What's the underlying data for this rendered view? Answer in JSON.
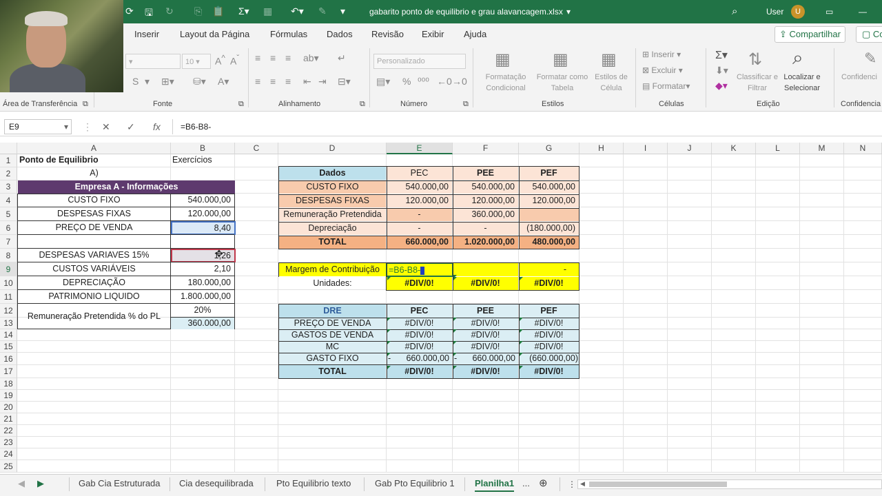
{
  "titlebar": {
    "filename": "gabarito ponto de equilibrio e grau alavancagem.xlsx",
    "user": "User",
    "user_initial": "U"
  },
  "ribbon_tabs": [
    "Inserir",
    "Layout da Página",
    "Fórmulas",
    "Dados",
    "Revisão",
    "Exibir",
    "Ajuda"
  ],
  "share": {
    "label": "Compartilhar",
    "label2": "Co"
  },
  "ribbon": {
    "groups": {
      "clipboard": "Área de Transferência",
      "font": "Fonte",
      "alignment": "Alinhamento",
      "number": "Número",
      "styles": "Estilos",
      "cells": "Células",
      "editing": "Edição",
      "confidentiality": "Confidencia"
    },
    "font_size": "10",
    "number_format": "Personalizado",
    "cond_format": "Formatação Condicional",
    "format_table": "Formatar como Tabela",
    "cell_styles": "Estilos de Célula",
    "insert": "Inserir",
    "delete": "Excluir",
    "format": "Formatar",
    "sort_filter": "Classificar e Filtrar",
    "find_select": "Localizar e Selecionar",
    "confidential": "Confidenci"
  },
  "formula_bar": {
    "name_box": "E9",
    "formula": "=B6-B8-"
  },
  "columns": [
    "A",
    "B",
    "C",
    "D",
    "E",
    "F",
    "G",
    "H",
    "I",
    "J",
    "K",
    "L",
    "M",
    "N"
  ],
  "rows": [
    "1",
    "2",
    "3",
    "4",
    "5",
    "6",
    "7",
    "8",
    "9",
    "10",
    "11",
    "12",
    "13",
    "14",
    "15",
    "16",
    "17",
    "18",
    "19",
    "20",
    "21",
    "22",
    "23",
    "24",
    "25"
  ],
  "sheet": {
    "a1": "Ponto de Equilibrio",
    "b1": "Exercícios",
    "a2": "A)",
    "company_header": "Empresa A - Informações",
    "left_table": [
      {
        "label": "CUSTO FIXO",
        "value": "540.000,00"
      },
      {
        "label": "DESPESAS FIXAS",
        "value": "120.000,00"
      },
      {
        "label": "PREÇO DE VENDA",
        "value": "8,40"
      },
      {
        "label": "",
        "value": ""
      },
      {
        "label": "DESPESAS VARIAVES 15%",
        "value": "1,26"
      },
      {
        "label": "CUSTOS VARIÁVEIS",
        "value": "2,10"
      },
      {
        "label": "DEPRECIAÇÃO",
        "value": "180.000,00"
      },
      {
        "label": "PATRIMONIO LIQUIDO",
        "value": "1.800.000,00"
      }
    ],
    "remuneracao_label": "Remuneração Pretendida  % do PL",
    "b12": "20%",
    "b13": "360.000,00",
    "dados": {
      "headers": [
        "Dados",
        "PEC",
        "PEE",
        "PEF"
      ],
      "rows": [
        [
          "CUSTO FIXO",
          "540.000,00",
          "540.000,00",
          "540.000,00"
        ],
        [
          "DESPESAS FIXAS",
          "120.000,00",
          "120.000,00",
          "120.000,00"
        ],
        [
          "Remuneração Pretendida",
          "-",
          "360.000,00",
          ""
        ],
        [
          "Depreciação",
          "-",
          "-",
          "(180.000,00)"
        ]
      ],
      "total": [
        "TOTAL",
        "660.000,00",
        "1.020.000,00",
        "480.000,00"
      ]
    },
    "margem": {
      "label": "Margem de Contribuição",
      "editing": "=B6-B8-",
      "f": "",
      "g": "-"
    },
    "unidades": {
      "label": "Unidades:",
      "e": "#DIV/0!",
      "f": "#DIV/0!",
      "g": "#DIV/0!"
    },
    "dre": {
      "headers": [
        "DRE",
        "PEC",
        "PEE",
        "PEF"
      ],
      "rows": [
        [
          "PREÇO DE VENDA",
          "#DIV/0!",
          "#DIV/0!",
          "#DIV/0!"
        ],
        [
          "GASTOS DE VENDA",
          "#DIV/0!",
          "#DIV/0!",
          "#DIV/0!"
        ],
        [
          "MC",
          "#DIV/0!",
          "#DIV/0!",
          "#DIV/0!"
        ]
      ],
      "gasto_fixo": {
        "label": "GASTO FIXO",
        "e_sign": "-",
        "e": "660.000,00",
        "f_sign": "-",
        "f": "660.000,00",
        "g": "(660.000,00)"
      },
      "total": [
        "TOTAL",
        "#DIV/0!",
        "#DIV/0!",
        "#DIV/0!"
      ]
    }
  },
  "sheet_tabs": [
    "Gab Cia Estruturada",
    "Cia desequilibrada",
    "Pto Equilibrio texto",
    "Gab Pto Equilibrio 1",
    "Planilha1",
    "..."
  ],
  "colors": {
    "excel_green": "#217346",
    "purple_header": "#5e3a6e",
    "light_blue": "#dbeef4",
    "header_blue": "#bde0ec",
    "salmon": "#f8cbad",
    "light_salmon": "#fce4d6",
    "total_salmon": "#f4b183",
    "yellow": "#ffff00"
  }
}
